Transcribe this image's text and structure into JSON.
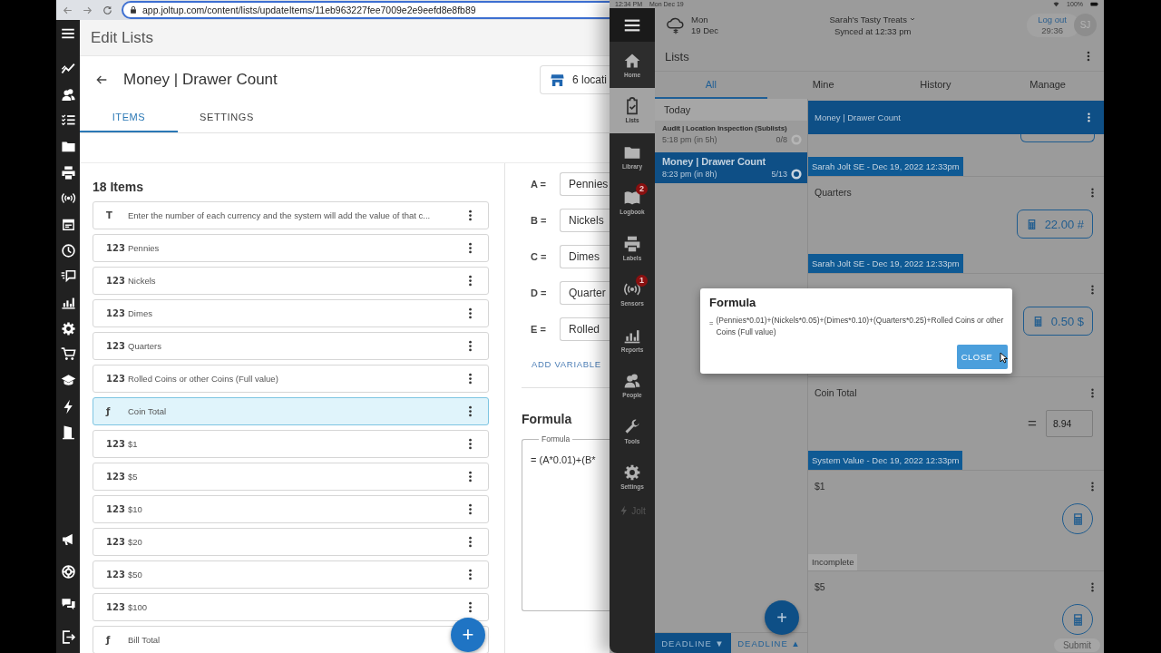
{
  "browser": {
    "url": "app.joltup.com/content/lists/updateItems/11eb963227fee7009e2e9eefd8e8fb89"
  },
  "editor": {
    "page_title": "Edit Lists",
    "list_title": "Money | Drawer Count",
    "locations_button": "6 locati",
    "tabs": [
      {
        "label": "ITEMS",
        "selected": true
      },
      {
        "label": "SETTINGS",
        "selected": false
      }
    ],
    "items_heading": "18 Items",
    "items": [
      {
        "icon": "T",
        "label": "Enter the number of each currency and the system will add the value of that c...",
        "selected": false
      },
      {
        "icon": "123",
        "label": "Pennies",
        "selected": false
      },
      {
        "icon": "123",
        "label": "Nickels",
        "selected": false
      },
      {
        "icon": "123",
        "label": "Dimes",
        "selected": false
      },
      {
        "icon": "123",
        "label": "Quarters",
        "selected": false
      },
      {
        "icon": "123",
        "label": "Rolled Coins or other Coins (Full value)",
        "selected": false
      },
      {
        "icon": "ƒ",
        "label": "Coin Total",
        "selected": true
      },
      {
        "icon": "123",
        "label": "$1",
        "selected": false
      },
      {
        "icon": "123",
        "label": "$5",
        "selected": false
      },
      {
        "icon": "123",
        "label": "$10",
        "selected": false
      },
      {
        "icon": "123",
        "label": "$20",
        "selected": false
      },
      {
        "icon": "123",
        "label": "$50",
        "selected": false
      },
      {
        "icon": "123",
        "label": "$100",
        "selected": false
      },
      {
        "icon": "ƒ",
        "label": "Bill Total",
        "selected": false
      }
    ],
    "add_button": "+",
    "variables": [
      {
        "letter": "A =",
        "value": "Pennies"
      },
      {
        "letter": "B =",
        "value": "Nickels"
      },
      {
        "letter": "C =",
        "value": "Dimes"
      },
      {
        "letter": "D =",
        "value": "Quarter"
      },
      {
        "letter": "E =",
        "value": "Rolled"
      }
    ],
    "add_variable": "ADD VARIABLE",
    "formula_heading": "Formula",
    "formula_field": {
      "label": "Formula",
      "value": "= (A*0.01)+(B*"
    }
  },
  "tablet": {
    "status": {
      "time": "12:34 PM",
      "date": "Mon Dec 19",
      "battery": "100%"
    },
    "nav": [
      {
        "label": "Home",
        "selected": false
      },
      {
        "label": "Lists",
        "selected": true
      },
      {
        "label": "Library",
        "selected": false
      },
      {
        "label": "Logbook",
        "selected": false,
        "badge": "2"
      },
      {
        "label": "Labels",
        "selected": false
      },
      {
        "label": "Sensors",
        "selected": false,
        "badge": "1"
      },
      {
        "label": "Reports",
        "selected": false
      },
      {
        "label": "People",
        "selected": false
      },
      {
        "label": "Tools",
        "selected": false
      },
      {
        "label": "Settings",
        "selected": false
      }
    ],
    "brand": "Jolt",
    "weather": {
      "day": "Mon",
      "date": "19 Dec"
    },
    "location": {
      "name": "Sarah's Tasty Treats",
      "synced": "Synced at 12:33 pm"
    },
    "session": {
      "logout": "Log out",
      "timer": "29:36"
    },
    "avatar": "SJ",
    "title": "Lists",
    "tabs": [
      {
        "label": "All",
        "selected": true
      },
      {
        "label": "Mine",
        "selected": false
      },
      {
        "label": "History",
        "selected": false
      },
      {
        "label": "Manage",
        "selected": false
      }
    ],
    "group": "Today",
    "lists": [
      {
        "title": "Audit | Location Inspection (Sublists)",
        "time": "5:18 pm (in 5h)",
        "progress": "0/8",
        "selected": false
      },
      {
        "title": "Money | Drawer Count",
        "time": "8:23 pm (in 8h)",
        "progress": "5/13",
        "selected": true
      }
    ],
    "add_button": "+",
    "sort_buttons": [
      {
        "label": "DEADLINE",
        "arrow": "▼",
        "selected": true
      },
      {
        "label": "DEADLINE",
        "arrow": "▲",
        "selected": false
      }
    ],
    "detail": {
      "title": "Money | Drawer Count",
      "entries": [
        {
          "kind": "tag",
          "text": "Sarah Jolt SE - Dec 19, 2022 12:33pm"
        },
        {
          "kind": "number",
          "label": "Quarters",
          "value": "22.00 #"
        },
        {
          "kind": "tag",
          "text": "Sarah Jolt SE - Dec 19, 2022 12:33pm"
        },
        {
          "kind": "number",
          "value": "0.50 $"
        },
        {
          "kind": "formula",
          "label": "Coin Total",
          "prefix": "=",
          "value": "8.94"
        },
        {
          "kind": "tag",
          "text": "System Value - Dec 19, 2022 12:33pm"
        },
        {
          "kind": "number",
          "label": "$1"
        },
        {
          "kind": "status",
          "text": "Incomplete"
        },
        {
          "kind": "number",
          "label": "$5"
        }
      ],
      "submit": "Submit"
    },
    "modal": {
      "title": "Formula",
      "prefix": "=",
      "text": "(Pennies*0.01)+(Nickels*0.05)+(Dimes*0.10)+(Quarters*0.25)+Rolled Coins or other Coins (Full value)",
      "button": "CLOSE"
    }
  }
}
